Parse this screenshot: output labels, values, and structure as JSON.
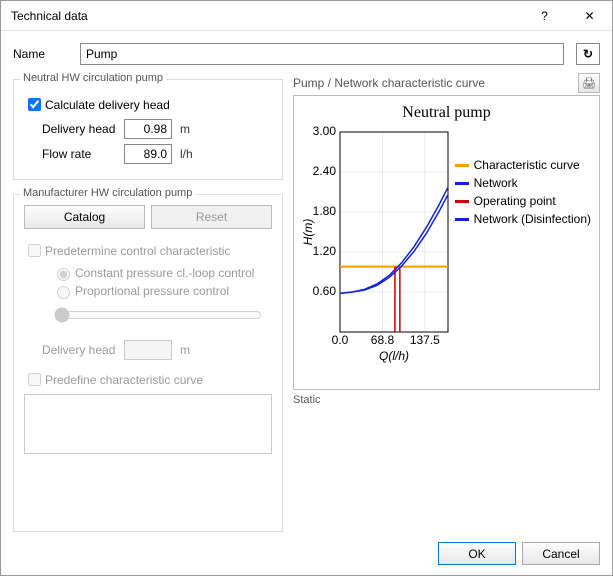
{
  "titlebar": {
    "title": "Technical data",
    "help_glyph": "?",
    "close_glyph": "✕"
  },
  "name_row": {
    "label": "Name",
    "value": "Pump",
    "refresh_glyph": "↻"
  },
  "neutral_group": {
    "title": "Neutral HW circulation pump",
    "calc_label": "Calculate delivery head",
    "calc_checked": true,
    "delivery_head_label": "Delivery head",
    "delivery_head_value": "0.98",
    "delivery_head_unit": "m",
    "flow_rate_label": "Flow rate",
    "flow_rate_value": "89.0",
    "flow_rate_unit": "l/h"
  },
  "manufacturer_group": {
    "title": "Manufacturer HW circulation pump",
    "catalog_label": "Catalog",
    "reset_label": "Reset",
    "predetermine_label": "Predetermine control characteristic",
    "const_pressure_label": "Constant pressure cl.-loop control",
    "prop_pressure_label": "Proportional pressure control",
    "delivery_head_label": "Delivery head",
    "delivery_head_value": "",
    "delivery_head_unit": "m",
    "predefine_curve_label": "Predefine characteristic curve"
  },
  "chart_header": {
    "label": "Pump / Network characteristic curve",
    "print_glyph": "🖨"
  },
  "chart_data": {
    "type": "line",
    "title": "Neutral pump",
    "xlabel": "Q(l/h)",
    "ylabel": "H(m)",
    "xlim": [
      0,
      175
    ],
    "ylim": [
      0,
      3.0
    ],
    "xticks": [
      0.0,
      68.8,
      137.5
    ],
    "yticks": [
      0.6,
      1.2,
      1.8,
      2.4,
      3.0
    ],
    "series": [
      {
        "name": "Characteristic curve",
        "color": "#ff9900",
        "style": "hline",
        "y": 0.98
      },
      {
        "name": "Network",
        "color": "#1122dd",
        "x": [
          0,
          20,
          40,
          60,
          80,
          100,
          120,
          140,
          160,
          175
        ],
        "y": [
          0.58,
          0.6,
          0.64,
          0.72,
          0.85,
          1.04,
          1.28,
          1.57,
          1.9,
          2.17
        ]
      },
      {
        "name": "Operating point",
        "color": "#cc0000",
        "style": "vlines",
        "x": [
          89.0,
          97.0
        ],
        "y0": 0,
        "y1_for_x": [
          0.98,
          0.98
        ]
      },
      {
        "name": "Network (Disinfection)",
        "color": "#1122dd",
        "x": [
          0,
          20,
          40,
          60,
          80,
          100,
          120,
          140,
          160,
          175
        ],
        "y": [
          0.58,
          0.6,
          0.63,
          0.7,
          0.82,
          0.99,
          1.21,
          1.48,
          1.8,
          2.06
        ]
      }
    ],
    "legend_position": "right",
    "grid": true
  },
  "static_label": "Static",
  "footer": {
    "ok_label": "OK",
    "cancel_label": "Cancel"
  }
}
